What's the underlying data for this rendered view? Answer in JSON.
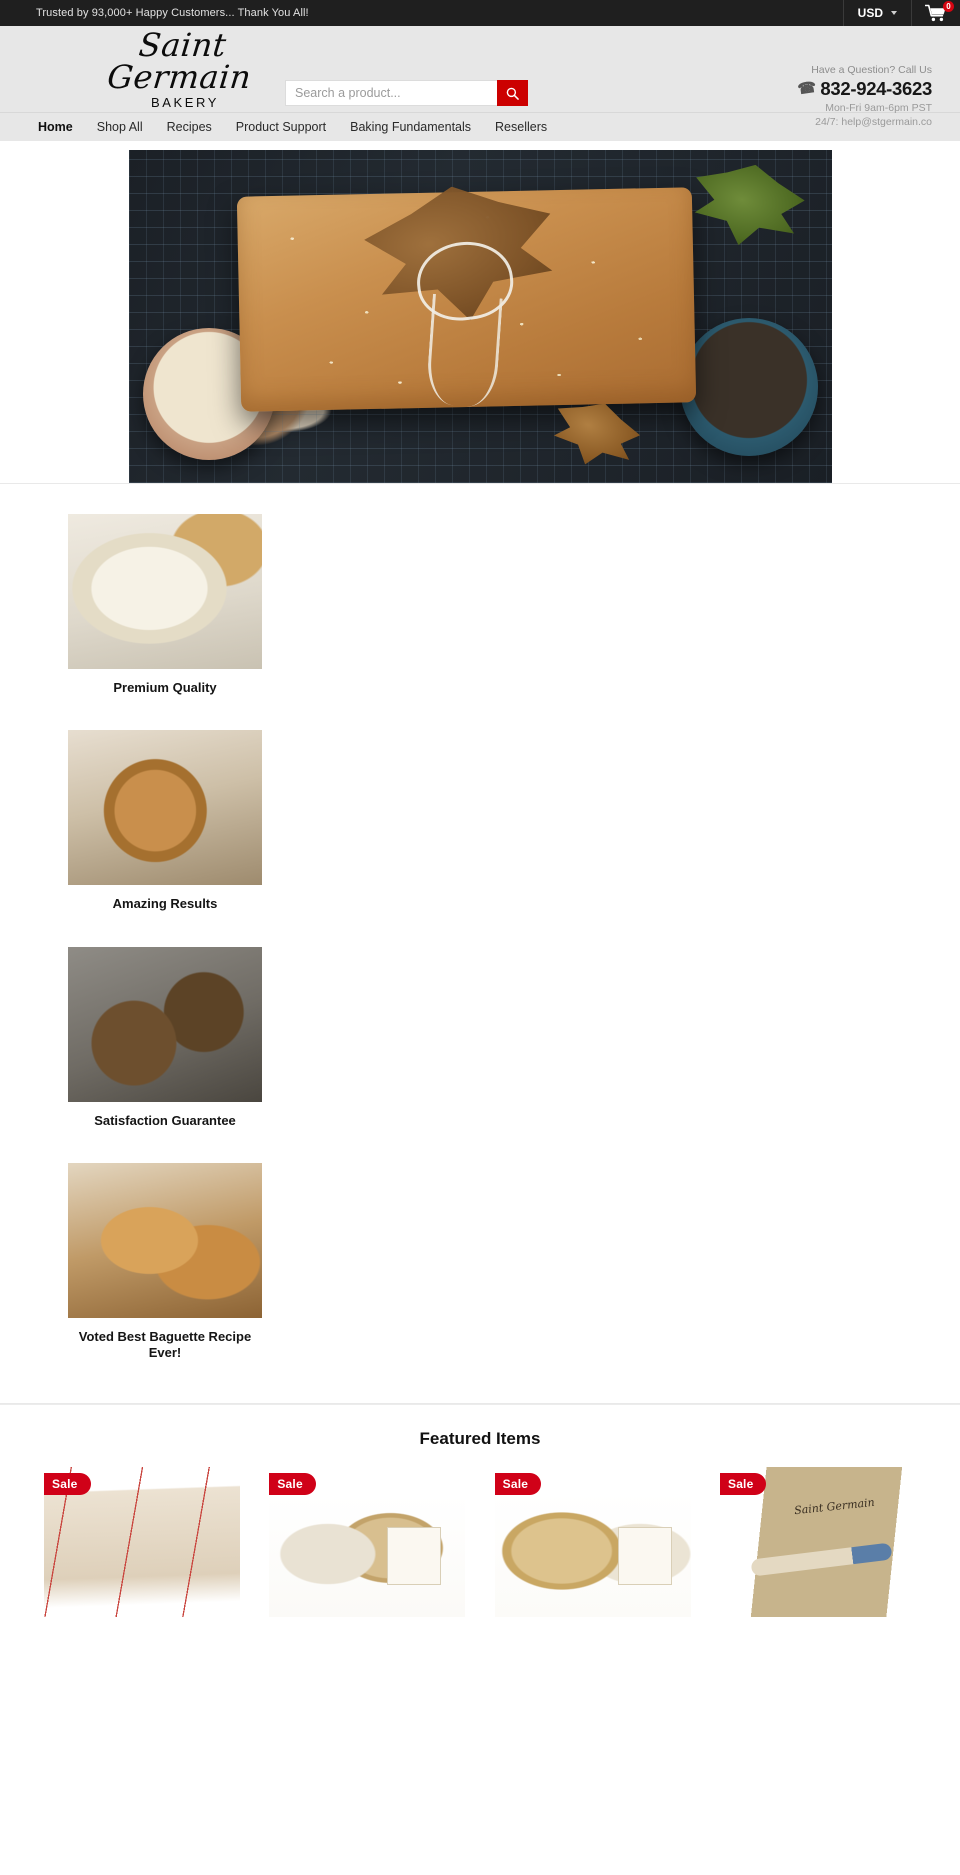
{
  "announcement": {
    "message": "Trusted by 93,000+ Happy Customers... Thank You All!",
    "currency": "USD",
    "cart_count": "0"
  },
  "header": {
    "logo_script": "Saint Germain",
    "logo_sub": "BAKERY",
    "search": {
      "placeholder": "Search a product...",
      "value": "",
      "button_icon": "search-icon"
    },
    "contact": {
      "question": "Have a Question? Call Us",
      "phone": "832-924-3623",
      "hours": "Mon-Fri 9am-6pm PST",
      "email": "24/7: help@stgermain.co"
    }
  },
  "nav": {
    "items": [
      {
        "label": "Home",
        "active": true
      },
      {
        "label": "Shop All",
        "active": false
      },
      {
        "label": "Recipes",
        "active": false
      },
      {
        "label": "Product Support",
        "active": false
      },
      {
        "label": "Baking Fundamentals",
        "active": false
      },
      {
        "label": "Resellers",
        "active": false
      }
    ]
  },
  "hero": {
    "alt": "Seeded artisan bread loaf on a cooling rack with autumn leaves and bowls of seeds"
  },
  "features": [
    {
      "label": "Premium Quality",
      "alt": "Sourdough starter in a white ceramic bowl"
    },
    {
      "label": "Amazing Results",
      "alt": "Round sourdough boule on a wooden board with knife"
    },
    {
      "label": "Satisfaction Guarantee",
      "alt": "Rustic seeded loaves with wheat stalks"
    },
    {
      "label": "Voted Best Baguette Recipe Ever!",
      "alt": "Freshly baked baguettes on linen"
    }
  ],
  "featured": {
    "title": "Featured Items",
    "products": [
      {
        "badge": "Sale",
        "alt": "Baker's couche proofing cloth with red stripes"
      },
      {
        "badge": "Sale",
        "alt": "Round banneton proofing basket with dough and packaging"
      },
      {
        "badge": "Sale",
        "alt": "Oval banneton proofing basket set with packaging"
      },
      {
        "badge": "Sale",
        "alt": "Premium bread lame with wooden handle and box"
      }
    ]
  },
  "colors": {
    "accent_red": "#cc0000",
    "sale_red": "#d00118",
    "dark_bar": "#1f1f1f",
    "header_gray": "#e7e7e7"
  }
}
